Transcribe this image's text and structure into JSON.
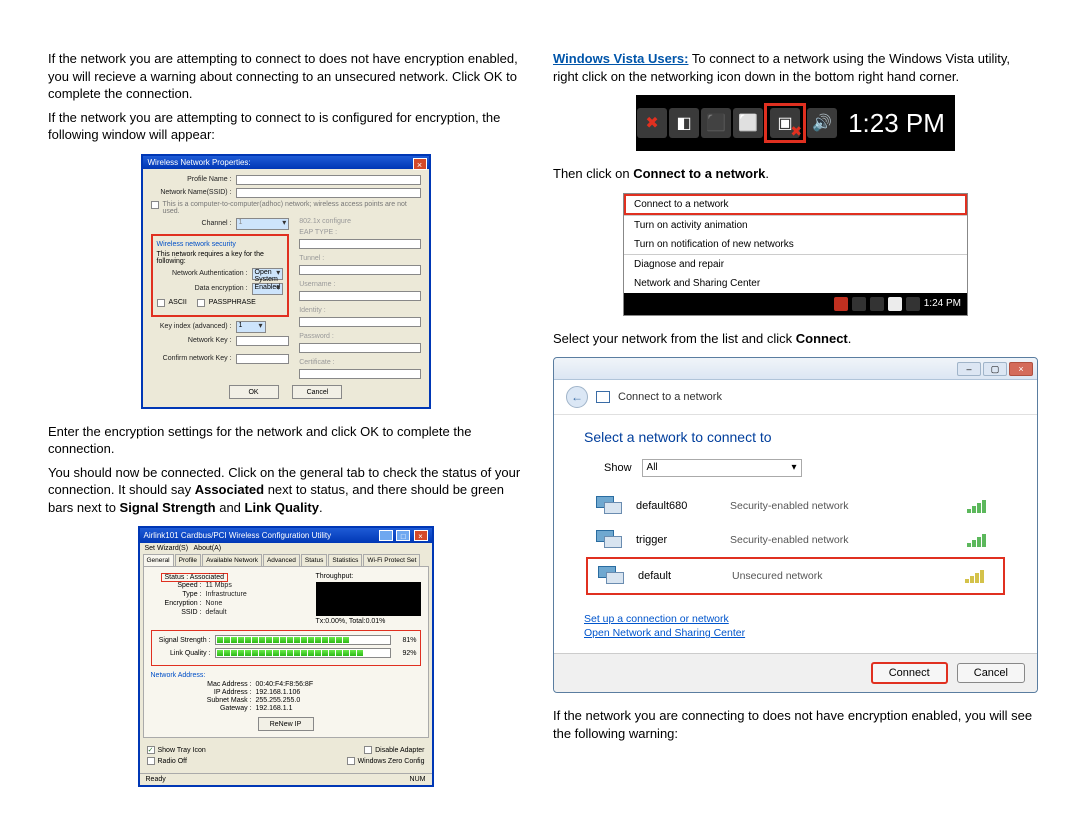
{
  "left": {
    "p1": "If the network you are attempting to connect to does not have encryption enabled, you will recieve a warning about connecting to an unsecured network.  Click OK to complete the connection.",
    "p2": "If the network you are attempting to connect to is configured for encryption, the following window will appear:",
    "p3": "Enter the encryption settings for the network and click OK to complete the connection.",
    "p4_a": "You should now be connected.  Click on the general tab to check the status of your connection.  It should say ",
    "p4_assoc": "Associated",
    "p4_b": " next to status, and there should be green bars next to ",
    "p4_ss": "Signal Strength",
    "p4_and": " and ",
    "p4_lq": "Link Quality",
    "p4_dot": "."
  },
  "right": {
    "vista_lead": "Windows Vista Users:",
    "vista_text": "  To connect to a network using the Windows Vista utility, right click on the networking icon down in the bottom right hand corner.",
    "then_click_a": "Then click on ",
    "then_click_b": "Connect to a network",
    "then_click_c": ".",
    "select_a": "Select your network from the list and click ",
    "select_b": "Connect",
    "select_c": ".",
    "last": "If the network you are connecting to does not have encryption enabled, you will see the following warning:"
  },
  "dlg1": {
    "title": "Wireless Network Properties:",
    "profile": "Profile Name :",
    "ssid": "Network Name(SSID) :",
    "adhoc": "This is a computer-to-computer(adhoc) network; wireless access points are not used.",
    "channel": "Channel :",
    "sec_title": "Wireless network security",
    "sec_subtitle": "This network requires a key for the following:",
    "auth": "Network Authentication :",
    "auth_val": "Open System",
    "enc": "Data encryption :",
    "enc_val": "Enabled",
    "ascii": "ASCII",
    "pass": "PASSPHRASE",
    "keyidx": "Key index (advanced) :",
    "netkey": "Network Key :",
    "confkey": "Confirm network Key :",
    "eap_cfg": "802.1x configure",
    "eaptype": "EAP TYPE :",
    "tunnel": "Tunnel :",
    "user": "Username :",
    "identity": "Identity :",
    "password": "Password :",
    "cert": "Certificate :",
    "ok": "OK",
    "cancel": "Cancel"
  },
  "dlg2": {
    "title": "Airlink101 Cardbus/PCI Wireless Configuration Utility",
    "menu_set": "Set Wizard(S)",
    "menu_about": "About(A)",
    "tabs": [
      "General",
      "Profile",
      "Available Network",
      "Advanced",
      "Status",
      "Statistics",
      "Wi-Fi Protect Set"
    ],
    "status_lbl": "Status :",
    "status_val": "Associated",
    "speed_lbl": "Speed :",
    "speed_val": "11 Mbps",
    "type_lbl": "Type :",
    "type_val": "Infrastructure",
    "enc_lbl": "Encryption :",
    "enc_val": "None",
    "ssid_lbl": "SSID :",
    "ssid_val": "default",
    "thru": "Throughput:",
    "thru_stats": "Tx:0.00%, Total:0.01%",
    "ss_lbl": "Signal Strength :",
    "ss_pct": "81%",
    "lq_lbl": "Link Quality :",
    "lq_pct": "92%",
    "addr_title": "Network Address:",
    "mac_lbl": "Mac Address :",
    "mac_val": "00:40:F4:F8:56:8F",
    "ip_lbl": "IP Address :",
    "ip_val": "192.168.1.106",
    "sm_lbl": "Subnet Mask :",
    "sm_val": "255.255.255.0",
    "gw_lbl": "Gateway :",
    "gw_val": "192.168.1.1",
    "renew": "ReNew IP",
    "opt_tray": "Show Tray Icon",
    "opt_disable": "Disable Adapter",
    "opt_radio": "Radio Off",
    "opt_zero": "Windows Zero Config",
    "foot_ready": "Ready",
    "foot_num": "NUM"
  },
  "tray": {
    "time1": "1:23 PM",
    "time2": "1:24 PM"
  },
  "menu": {
    "connect": "Connect to a network",
    "anim": "Turn on activity animation",
    "notif": "Turn on notification of new networks",
    "diag": "Diagnose and repair",
    "center": "Network and Sharing Center"
  },
  "ctw": {
    "hdr": "Connect to a network",
    "subhead": "Select a network to connect to",
    "show": "Show",
    "show_val": "All",
    "nets": [
      {
        "name": "default680",
        "sec": "Security-enabled network"
      },
      {
        "name": "trigger",
        "sec": "Security-enabled network"
      },
      {
        "name": "default",
        "sec": "Unsecured network"
      }
    ],
    "link1": "Set up a connection or network",
    "link2": "Open Network and Sharing Center",
    "connect": "Connect",
    "cancel": "Cancel"
  }
}
